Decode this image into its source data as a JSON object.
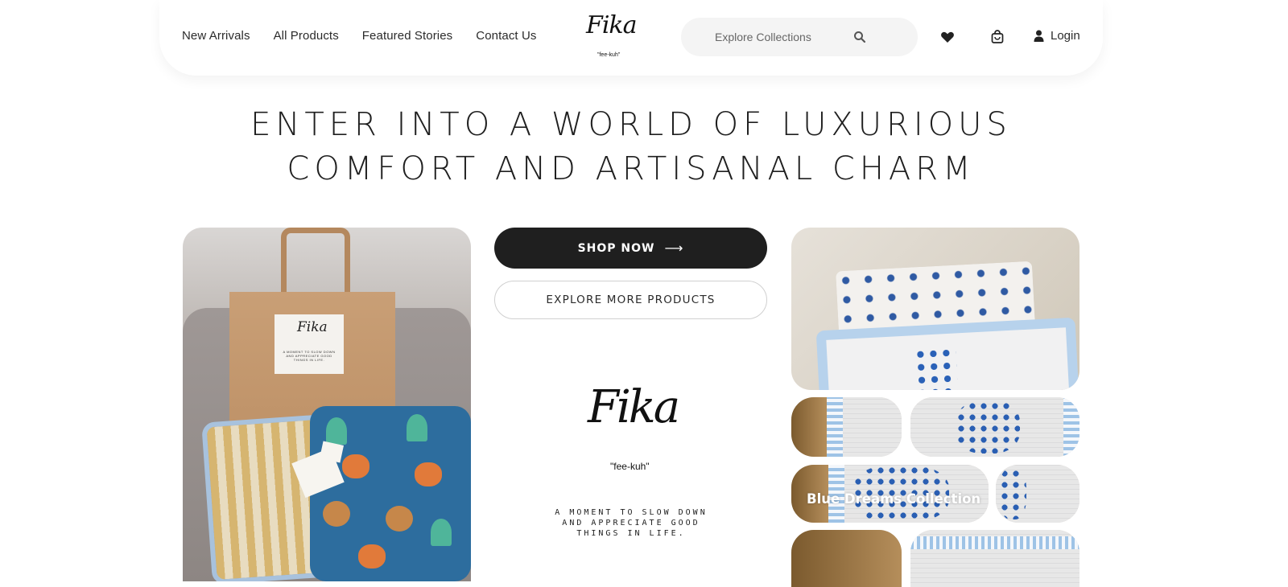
{
  "header": {
    "nav": [
      "New Arrivals",
      "All Products",
      "Featured Stories",
      "Contact Us"
    ],
    "logo_script": "Fika",
    "logo_sub": "\"fee-kuh\"",
    "search_placeholder": "Explore Collections",
    "login_label": "Login"
  },
  "hero": {
    "line1": "ENTER INTO A WORLD OF LUXURIOUS",
    "line2": "COMFORT AND ARTISANAL CHARM"
  },
  "cta": {
    "shop_now": "SHOP NOW",
    "shop_arrow": "⟶",
    "explore": "EXPLORE MORE PRODUCTS"
  },
  "brand": {
    "script": "Fika",
    "pronunciation": "\"fee-kuh\"",
    "tagline_1": "A MOMENT TO SLOW DOWN",
    "tagline_2": "AND APPRECIATE GOOD",
    "tagline_3": "THINGS IN LIFE."
  },
  "bag_label": {
    "script": "Fika",
    "sub": "A MOMENT TO SLOW DOWN AND APPRECIATE GOOD THINGS IN LIFE."
  },
  "collection": {
    "caption": "Blue Dreams Collection"
  },
  "icons": [
    "search-icon",
    "heart-icon",
    "cart-icon",
    "user-icon",
    "arrow-right-icon"
  ]
}
